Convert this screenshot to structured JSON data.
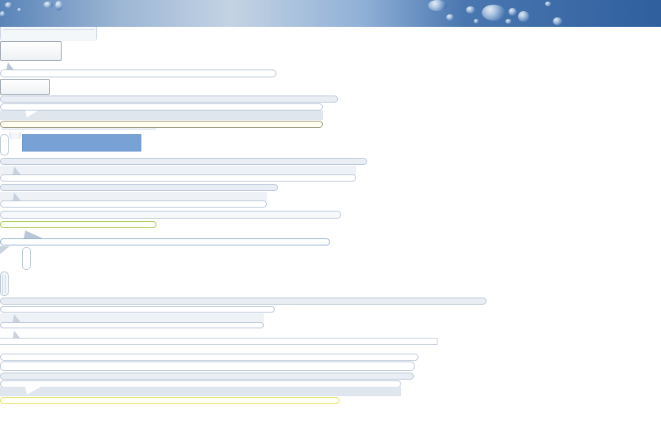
{
  "banner": {
    "accent": "#2f5f9e",
    "light": "#c4d3e4"
  },
  "controls": {
    "button_large_label": "",
    "button_small_label": "",
    "selected_row_label": ""
  },
  "colors": {
    "border": "#b9c6d8",
    "fill": "#e9eef4",
    "cream": "#fffdf0",
    "green": "#a9c24b",
    "yellow": "#e4e067",
    "selected": "#78a2d6"
  }
}
